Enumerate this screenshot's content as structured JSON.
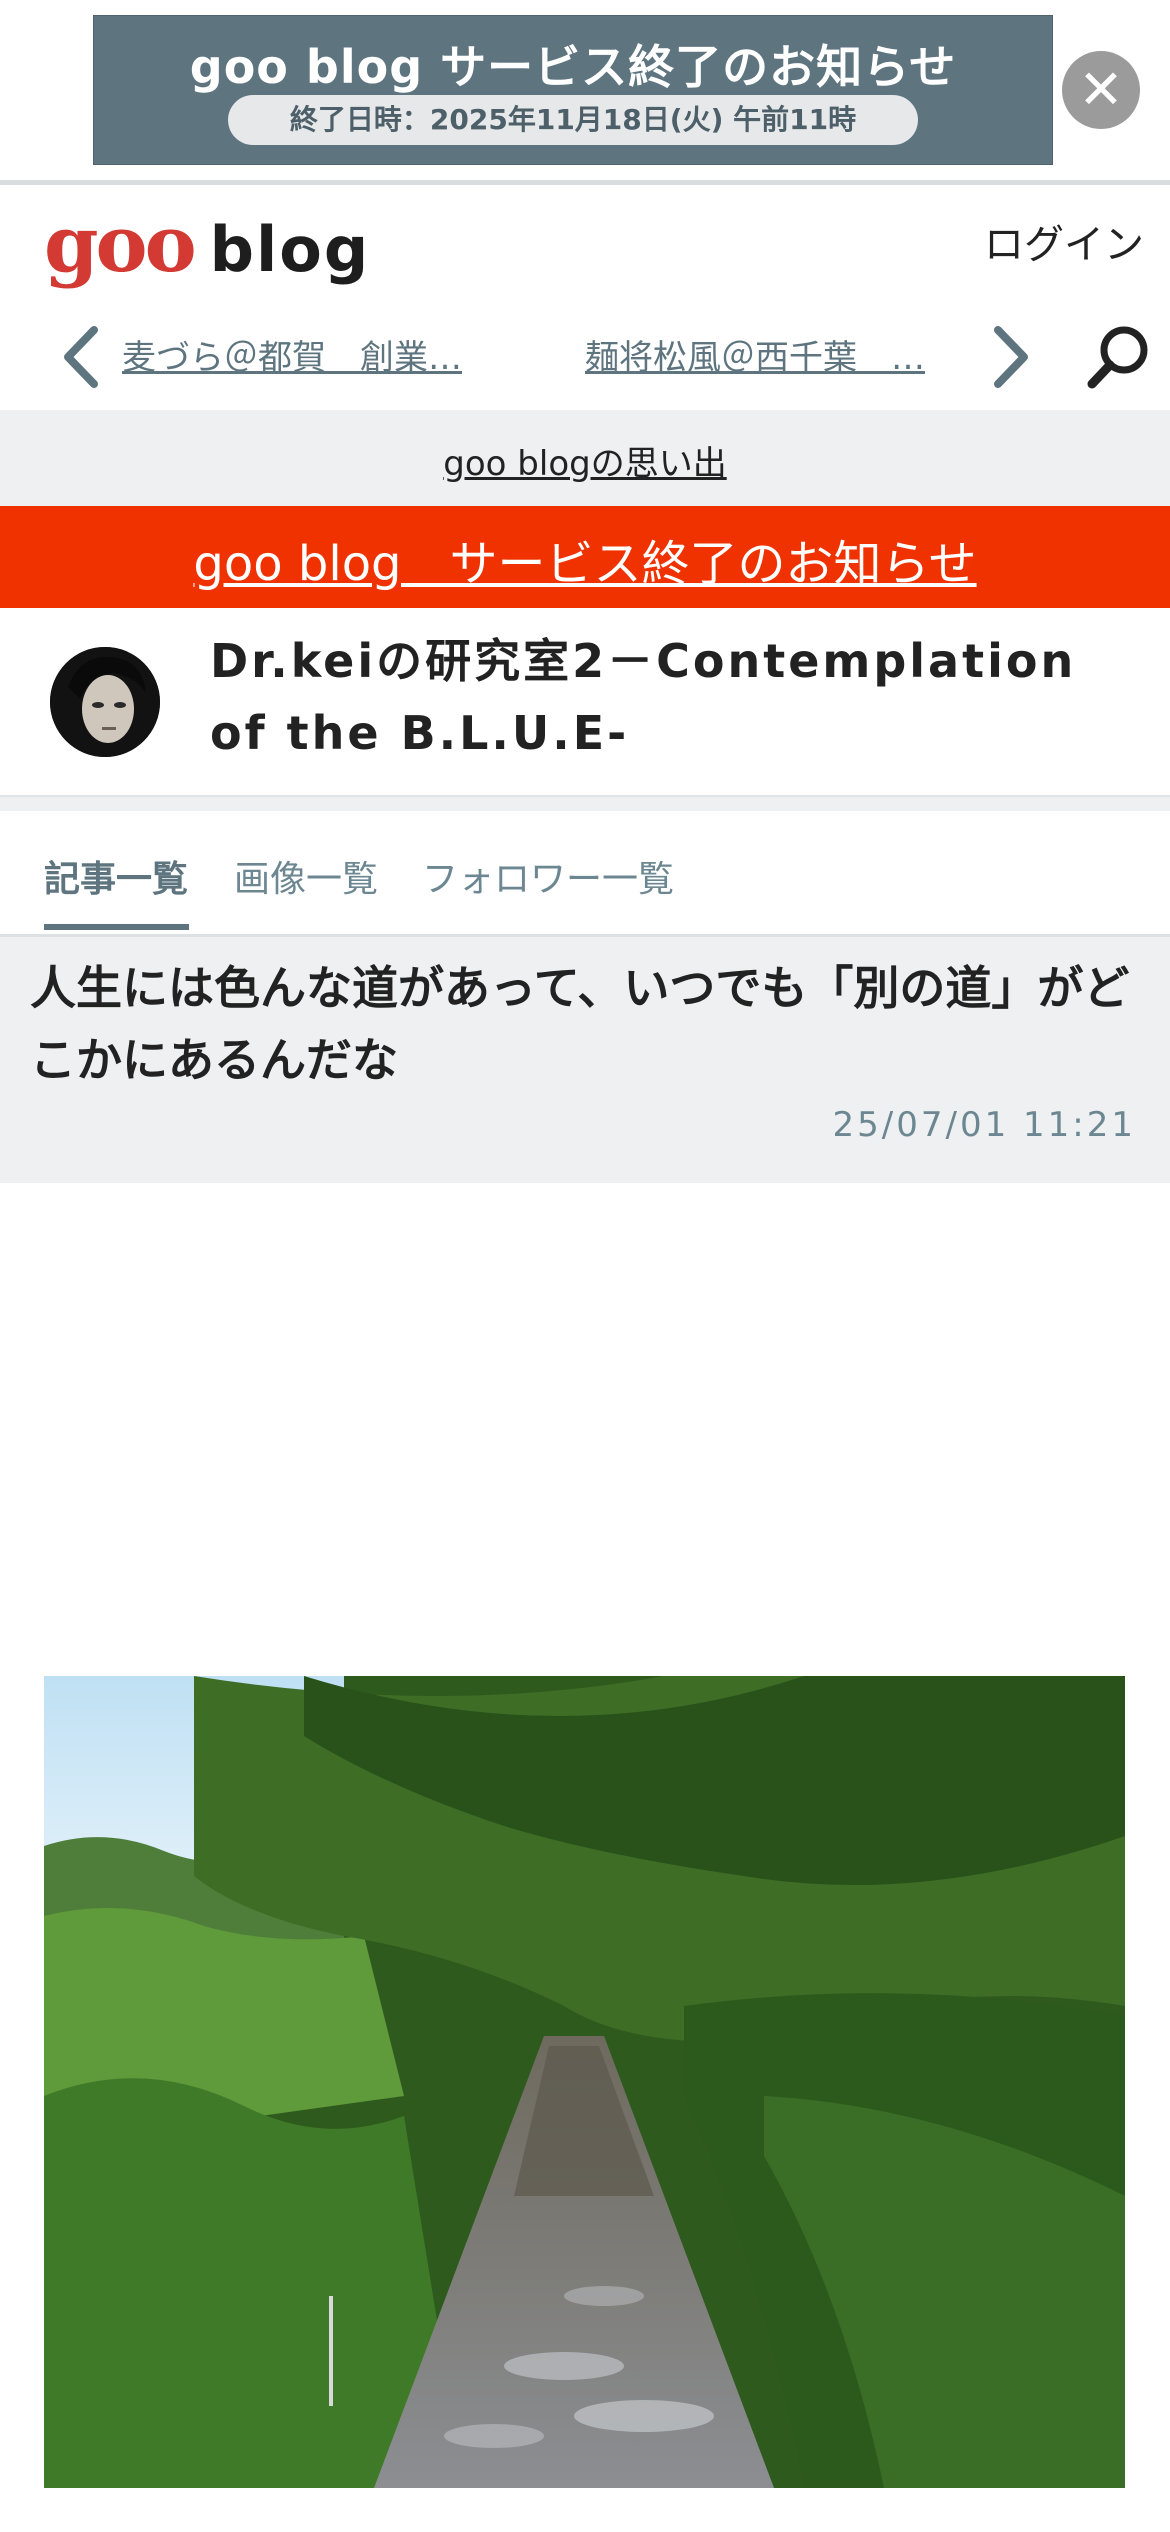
{
  "banner": {
    "title": "goo blog サービス終了のお知らせ",
    "end_datetime": "終了日時：2025年11月18日(火) 午前11時",
    "close_icon": "close-icon"
  },
  "header": {
    "logo_goo": "goo",
    "logo_blog": "blog",
    "login": "ログイン"
  },
  "recent": {
    "items": [
      "麦づら＠都賀　創業…",
      "麺将松風＠西千葉　…"
    ],
    "prev_icon": "chevron-left-icon",
    "next_icon": "chevron-right-icon",
    "search_icon": "search-icon"
  },
  "memory_link": "goo blogの思い出",
  "end_notice_link": "goo blog　サービス終了のお知らせ",
  "blog": {
    "title": "Dr.keiの研究室2－Contemplation of the B.L.U.E-"
  },
  "tabs": [
    "記事一覧",
    "画像一覧",
    "フォロワー一覧"
  ],
  "article": {
    "title": "人生には色んな道があって、いつでも「別の道」がどこかにあるんだな",
    "date": "25/07/01 11:21"
  },
  "colors": {
    "banner_bg": "#5e7580",
    "accent": "#5e7580",
    "end_bar": "#f03200",
    "logo_red": "#d23a33"
  }
}
